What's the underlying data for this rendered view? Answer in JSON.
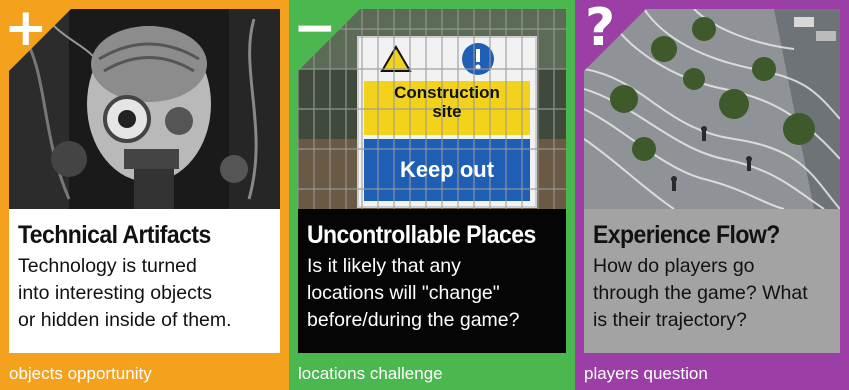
{
  "cards": [
    {
      "symbol": "+",
      "title": "Technical Artifacts",
      "description": "Technology is turned\ninto interesting objects\nor hidden inside of them.",
      "tag": "objects opportunity",
      "color": "#f4a11e",
      "panel_bg": "#ffffff",
      "panel_text": "#111111",
      "image": "robot-head-photo"
    },
    {
      "symbol": "−",
      "title": "Uncontrollable Places",
      "description": "Is it likely that any\nlocations will \"change\"\nbefore/during the game?",
      "tag": "locations challenge",
      "color": "#4ab84f",
      "panel_bg": "#050505",
      "panel_text": "#ffffff",
      "image": "construction-site-sign-photo",
      "sign": {
        "top": "Construction\nsite",
        "bottom": "Keep out"
      }
    },
    {
      "symbol": "?",
      "title": "Experience Flow?",
      "description": "How do players go\nthrough the game? What\nis their trajectory?",
      "tag": "players question",
      "color": "#9b3fa7",
      "panel_bg": "#a3a3a3",
      "panel_text": "#111111",
      "image": "urban-plaza-palm-trees-photo"
    }
  ]
}
